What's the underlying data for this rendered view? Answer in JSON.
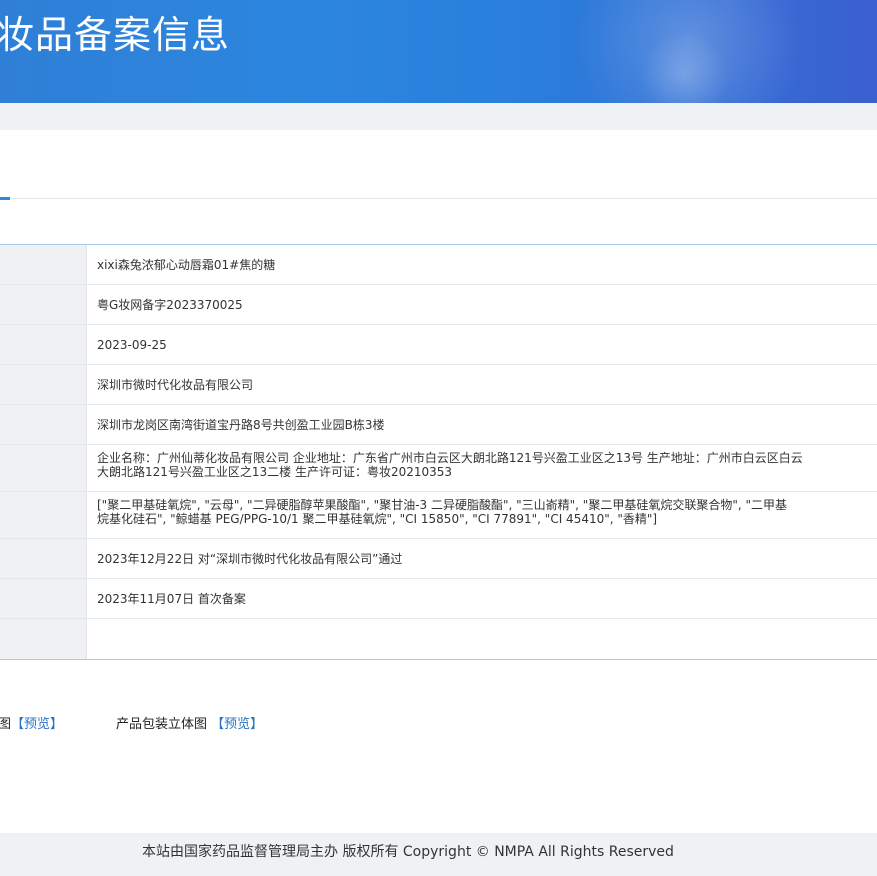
{
  "banner": {
    "title": "妆品备案信息"
  },
  "records": [
    {
      "value": "xixi森兔浓郁心动唇霜01#焦的糖"
    },
    {
      "value": "粤G妆网备字2023370025"
    },
    {
      "value": "2023-09-25"
    },
    {
      "value": "深圳市微时代化妆品有限公司"
    },
    {
      "value": "深圳市龙岗区南湾街道宝丹路8号共创盈工业园B栋3楼"
    },
    {
      "lines": [
        "企业名称：广州仙蒂化妆品有限公司 企业地址：广东省广州市白云区大朗北路121号兴盈工业区之13号 生产地址：广州市白云区白云",
        "大朗北路121号兴盈工业区之13二楼 生产许可证：粤妆20210353"
      ]
    },
    {
      "lines": [
        "[\"聚二甲基硅氧烷\", \"云母\", \"二异硬脂醇苹果酸酯\", \"聚甘油-3 二异硬脂酸酯\", \"三山嵛精\", \"聚二甲基硅氧烷交联聚合物\", \"二甲基",
        "烷基化硅石\", \"鲸蜡基 PEG/PPG-10/1 聚二甲基硅氧烷\", \"CI 15850\", \"CI 77891\", \"CI 45410\", \"香精\"]"
      ]
    },
    {
      "value": "2023年12月22日 对“深圳市微时代化妆品有限公司”通过"
    },
    {
      "value": "2023年11月07日 首次备案"
    },
    {
      "value": ""
    }
  ],
  "attachments": {
    "first_label": "图",
    "first_link": "【预览】",
    "second_label": "产品包装立体图 ",
    "second_link": "【预览】"
  },
  "footer": {
    "text": "本站由国家药品监督管理局主办 版权所有 Copyright © NMPA All Rights Reserved"
  },
  "colors": {
    "banner": "#2c86df",
    "link": "#2b73c0",
    "table_border": "#a9c9ec",
    "label_bg": "#f0f1f3"
  }
}
